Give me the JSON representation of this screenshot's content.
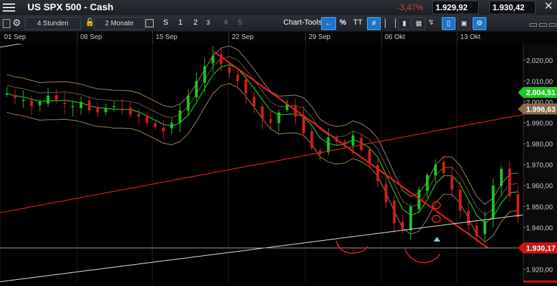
{
  "header": {
    "title": "US SPX 500 - Cash",
    "change": "-3,47%",
    "bid": "1.929,92",
    "ask": "1.930,42",
    "bid_arrow_color": "#f28c1c",
    "ask_arrow_color": "#3aa8ff"
  },
  "toolbar": {
    "interval": "4 Stunden",
    "range": "2 Monate",
    "s_label": "S",
    "n1": "1",
    "n2": "2",
    "n3": "3",
    "n4": "4",
    "n5": "5",
    "chart_tools": "Chart-Tools",
    "percent": "%",
    "text_tool": "TT"
  },
  "dates": [
    "01 Sep",
    "08 Sep",
    "15 Sep",
    "22 Sep",
    "29 Sep",
    "06 Okt",
    "13 Okt"
  ],
  "y_axis": {
    "ticks": [
      "2.020,00",
      "2.010,00",
      "2.000,00",
      "1.990,00",
      "1.980,00",
      "1.970,00",
      "1.960,00",
      "1.950,00",
      "1.940,00",
      "1.930,00",
      "1.920,00"
    ],
    "tick_values": [
      2020,
      2010,
      2000,
      1990,
      1980,
      1970,
      1960,
      1950,
      1940,
      1930,
      1920
    ],
    "labels": {
      "upper": "2.004,51",
      "middle": "1.996,63",
      "current": "1.930,17"
    },
    "label_values": {
      "upper": 2004.51,
      "middle": 1996.63,
      "current": 1930.17
    },
    "colors": {
      "upper": "#23c626",
      "middle": "#8a6d4d",
      "current": "#c81616"
    }
  },
  "chart_data": {
    "type": "candlestick",
    "title": "",
    "ylim": [
      1913.6,
      2027.8
    ],
    "x": [
      "01 Sep",
      "08 Sep",
      "15 Sep",
      "22 Sep",
      "29 Sep",
      "06 Okt",
      "13 Okt"
    ],
    "close_path": [
      2004,
      2002,
      2001,
      1998,
      2000,
      2003,
      2001,
      1999,
      1998,
      2000,
      1996,
      1995,
      1997,
      1998,
      1996,
      1994,
      1993,
      1990,
      1988,
      1986,
      1990,
      1996,
      2003,
      2010,
      2017,
      2022,
      2018,
      2014,
      2010,
      2004,
      1998,
      1992,
      1990,
      1995,
      1999,
      1993,
      1985,
      1978,
      1975,
      1983,
      1981,
      1980,
      1984,
      1977,
      1971,
      1962,
      1952,
      1942,
      1939,
      1950,
      1958,
      1965,
      1970,
      1966,
      1958,
      1948,
      1941,
      1936,
      1943,
      1960,
      1968,
      1955,
      1945
    ],
    "series_colors": [
      "#22c422",
      "#d21c1c",
      "#c9a46b"
    ],
    "current": 1930.17,
    "annotation_color": "#e02020"
  }
}
